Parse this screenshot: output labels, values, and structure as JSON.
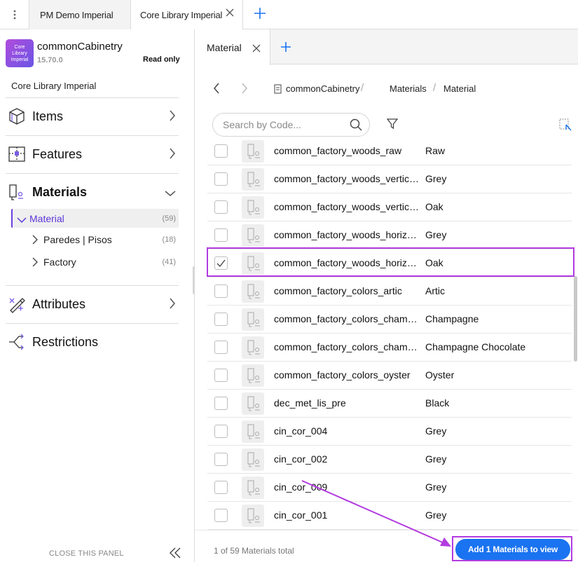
{
  "tabs": [
    {
      "label": "PM Demo Imperial"
    },
    {
      "label": "Core Library Imperial"
    }
  ],
  "library": {
    "logo_text": "Core Library Imperial",
    "name": "commonCabinetry",
    "version": "15.70.0",
    "access": "Read only",
    "title": "Core Library Imperial"
  },
  "nav": {
    "items": {
      "label": "Items"
    },
    "features": {
      "label": "Features"
    },
    "materials": {
      "label": "Materials"
    },
    "attributes": {
      "label": "Attributes"
    },
    "restrictions": {
      "label": "Restrictions"
    }
  },
  "tree": [
    {
      "label": "Material",
      "count": "(59)"
    },
    {
      "label": "Paredes | Pisos",
      "count": "(18)"
    },
    {
      "label": "Factory",
      "count": "(41)"
    }
  ],
  "close_panel": "CLOSE THIS PANEL",
  "right_tab": {
    "label": "Material"
  },
  "breadcrumb": [
    "commonCabinetry 1114:",
    "Materials",
    "Material"
  ],
  "search": {
    "placeholder": "Search by Code..."
  },
  "rows": [
    {
      "code": "common_factory_woods_raw",
      "name": "Raw",
      "checked": false
    },
    {
      "code": "common_factory_woods_vertic…",
      "name": "Grey",
      "checked": false
    },
    {
      "code": "common_factory_woods_vertic…",
      "name": "Oak",
      "checked": false
    },
    {
      "code": "common_factory_woods_horiz…",
      "name": "Grey",
      "checked": false
    },
    {
      "code": "common_factory_woods_horiz…",
      "name": "Oak",
      "checked": true
    },
    {
      "code": "common_factory_colors_artic",
      "name": "Artic",
      "checked": false
    },
    {
      "code": "common_factory_colors_cham…",
      "name": "Champagne",
      "checked": false
    },
    {
      "code": "common_factory_colors_cham…",
      "name": "Champagne Chocolate",
      "checked": false
    },
    {
      "code": "common_factory_colors_oyster",
      "name": "Oyster",
      "checked": false
    },
    {
      "code": "dec_met_lis_pre",
      "name": "Black",
      "checked": false
    },
    {
      "code": "cin_cor_004",
      "name": "Grey",
      "checked": false
    },
    {
      "code": "cin_cor_002",
      "name": "Grey",
      "checked": false
    },
    {
      "code": "cin_cor_009",
      "name": "Grey",
      "checked": false
    },
    {
      "code": "cin_cor_001",
      "name": "Grey",
      "checked": false
    }
  ],
  "footer": {
    "total": "1 of 59 Materials total",
    "add_button": "Add 1 Materials to view"
  },
  "colors": {
    "accent": "#1a73f0",
    "selection": "#5b36d8",
    "annotation": "#b23be0"
  }
}
